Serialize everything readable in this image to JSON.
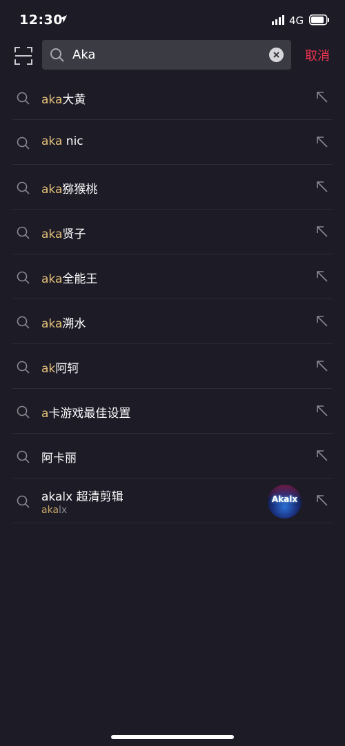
{
  "status": {
    "time": "12:30",
    "network": "4G"
  },
  "search": {
    "value": "Aka",
    "cancel_label": "取消"
  },
  "suggestions": [
    {
      "hl": "aka",
      "rest": "大黄"
    },
    {
      "hl": "aka",
      "rest": " nic"
    },
    {
      "hl": "aka",
      "rest": "猕猴桃"
    },
    {
      "hl": "aka",
      "rest": "贤子"
    },
    {
      "hl": "aka",
      "rest": "全能王"
    },
    {
      "hl": "aka",
      "rest": "溯水"
    },
    {
      "hl": "ak",
      "rest": "阿轲"
    },
    {
      "hl": "a",
      "rest": "卡游戏最佳设置"
    },
    {
      "hl": "",
      "rest": "阿卡丽"
    }
  ],
  "user_suggestion": {
    "title": "akalx 超清剪辑",
    "sub_hl": "aka",
    "sub_rest": "lx",
    "avatar_text": "Akalx"
  },
  "colors": {
    "highlight": "#e6c27a",
    "cancel": "#f0344f",
    "background": "#1c1b26"
  }
}
